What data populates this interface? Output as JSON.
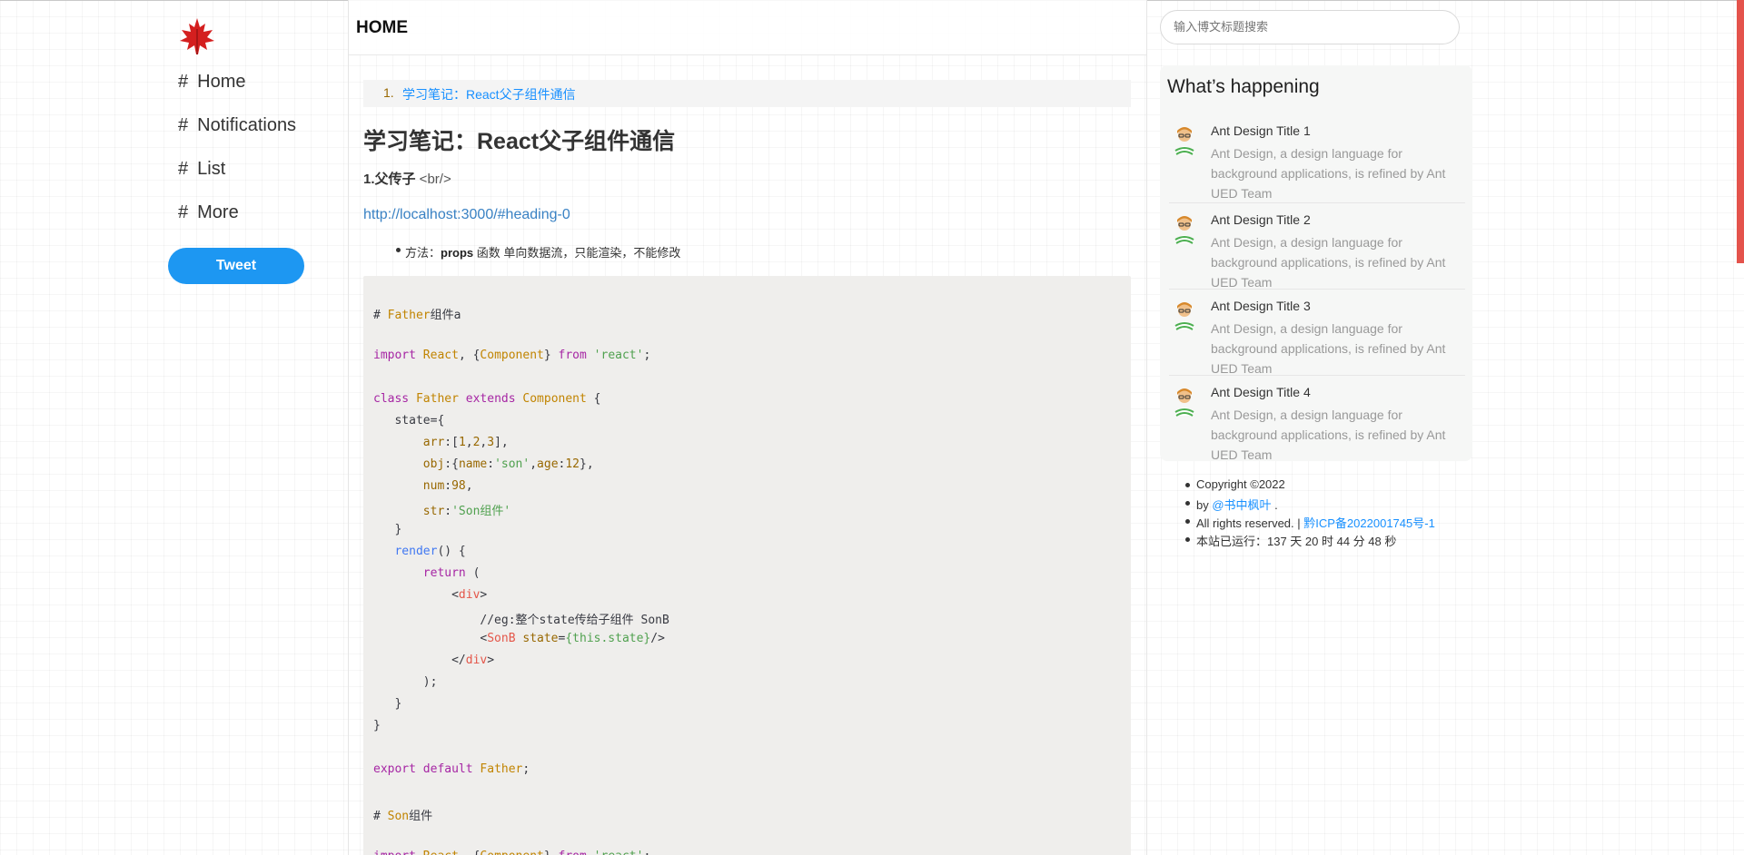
{
  "nav": {
    "items": [
      {
        "hash": "#",
        "label": "Home"
      },
      {
        "hash": "#",
        "label": "Notifications"
      },
      {
        "hash": "#",
        "label": "List"
      },
      {
        "hash": "#",
        "label": "More"
      }
    ],
    "tweet_label": "Tweet",
    "logo_icon": "maple-leaf-icon"
  },
  "header": {
    "title": "HOME"
  },
  "article": {
    "toc": [
      {
        "num": "1.",
        "text": "学习笔记：React父子组件通信"
      }
    ],
    "title": "学习笔记：React父子组件通信",
    "sub_heading": "1.父传子",
    "sub_heading_tag": " <br/>",
    "link": "http://localhost:3000/#heading-0",
    "bullet_prefix": "方法：",
    "bullet_bold": "props",
    "bullet_rest": " 函数 单向数据流，只能渲染，不能修改"
  },
  "search": {
    "placeholder": "输入博文标题搜索"
  },
  "happening": {
    "title": "What’s happening",
    "items": [
      {
        "title": "Ant Design Title 1",
        "desc": "Ant Design, a design language for background applications, is refined by Ant UED Team"
      },
      {
        "title": "Ant Design Title 2",
        "desc": "Ant Design, a design language for background applications, is refined by Ant UED Team"
      },
      {
        "title": "Ant Design Title 3",
        "desc": "Ant Design, a design language for background applications, is refined by Ant UED Team"
      },
      {
        "title": "Ant Design Title 4",
        "desc": "Ant Design, a design language for background applications, is refined by Ant UED Team"
      }
    ]
  },
  "footer": {
    "copyright": "Copyright ©2022",
    "by_prefix": "by ",
    "author": "@书中枫叶",
    "by_suffix": " .",
    "rights": "All rights reserved. | ",
    "icp": "黔ICP备2022001745号-1",
    "runtime": "本站已运行：137 天 20 时 44 分 48 秒"
  },
  "colors": {
    "accent": "#1890ff",
    "tweet": "#1d97f2",
    "scrollbar": "#e4534c"
  }
}
